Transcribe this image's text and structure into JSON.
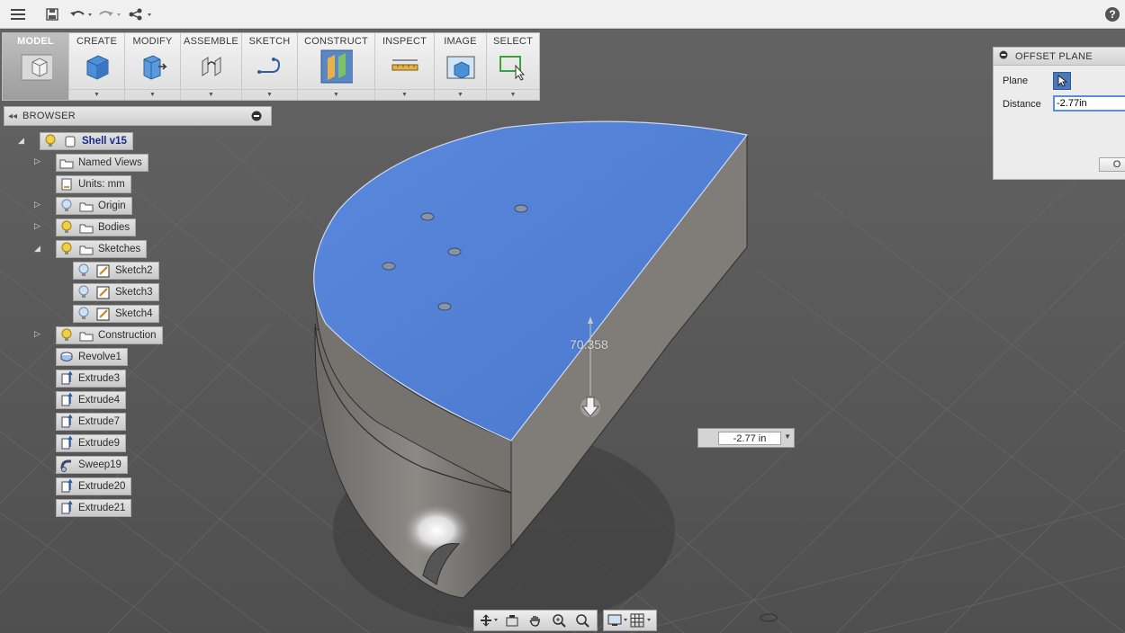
{
  "toolbar": {
    "tabs": [
      {
        "label": "MODEL"
      },
      {
        "label": "CREATE"
      },
      {
        "label": "MODIFY"
      },
      {
        "label": "ASSEMBLE"
      },
      {
        "label": "SKETCH"
      },
      {
        "label": "CONSTRUCT"
      },
      {
        "label": "INSPECT"
      },
      {
        "label": "IMAGE"
      },
      {
        "label": "SELECT"
      }
    ]
  },
  "browser": {
    "title": "BROWSER",
    "items": [
      {
        "label": "Shell v15",
        "icon": "component-icon"
      },
      {
        "label": "Named Views",
        "icon": "folder-icon"
      },
      {
        "label": "Units: mm",
        "icon": "document-icon"
      },
      {
        "label": "Origin",
        "icon": "folder-icon"
      },
      {
        "label": "Bodies",
        "icon": "folder-icon"
      },
      {
        "label": "Sketches",
        "icon": "folder-icon"
      },
      {
        "label": "Sketch2",
        "icon": "sketch-icon"
      },
      {
        "label": "Sketch3",
        "icon": "sketch-icon"
      },
      {
        "label": "Sketch4",
        "icon": "sketch-icon"
      },
      {
        "label": "Construction",
        "icon": "folder-icon"
      },
      {
        "label": "Revolve1",
        "icon": "revolve-icon"
      },
      {
        "label": "Extrude3",
        "icon": "extrude-icon"
      },
      {
        "label": "Extrude4",
        "icon": "extrude-icon"
      },
      {
        "label": "Extrude7",
        "icon": "extrude-icon"
      },
      {
        "label": "Extrude9",
        "icon": "extrude-icon"
      },
      {
        "label": "Sweep19",
        "icon": "sweep-icon"
      },
      {
        "label": "Extrude20",
        "icon": "extrude-icon"
      },
      {
        "label": "Extrude21",
        "icon": "extrude-icon"
      }
    ]
  },
  "dialog": {
    "title": "OFFSET PLANE",
    "plane_label": "Plane",
    "distance_label": "Distance",
    "distance_value": "-2.77in",
    "ok_label": "O"
  },
  "canvas": {
    "distance_value": "-2.77 in",
    "dimension_label": "70.358"
  },
  "colors": {
    "selected_face": "#4f7fd6",
    "body": "#7a7672",
    "accent": "#4a78b8"
  }
}
